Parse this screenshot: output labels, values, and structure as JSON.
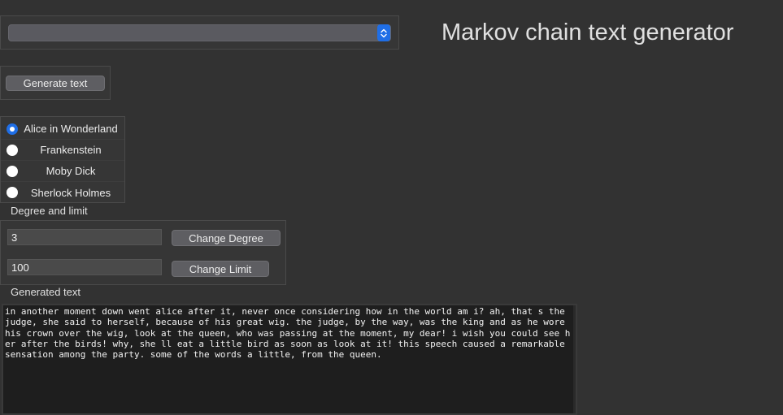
{
  "header": {
    "title": "Markov chain text generator"
  },
  "dropdown": {
    "selected": ""
  },
  "actions": {
    "generate_label": "Generate text"
  },
  "books": [
    {
      "label": "Alice in Wonderland",
      "checked": true
    },
    {
      "label": "Frankenstein",
      "checked": false
    },
    {
      "label": "Moby Dick",
      "checked": false
    },
    {
      "label": "Sherlock Holmes",
      "checked": false
    }
  ],
  "settings": {
    "caption": "Degree and limit",
    "degree_value": "3",
    "limit_value": "100",
    "change_degree_label": "Change Degree",
    "change_limit_label": "Change Limit"
  },
  "output": {
    "caption": "Generated text",
    "text": "in another moment down went alice after it, never once considering how in the world am i? ah, that s the judge, she said to herself, because of his great wig. the judge, by the way, was the king and as he wore his crown over the wig, look at the queen, who was passing at the moment, my dear! i wish you could see her after the birds! why, she ll eat a little bird as soon as look at it! this speech caused a remarkable sensation among the party. some of the words a little, from the queen."
  },
  "colors": {
    "accent": "#1f6ee6",
    "background": "#323232"
  },
  "icons": {
    "dropdown": "chevron-updown-icon"
  }
}
